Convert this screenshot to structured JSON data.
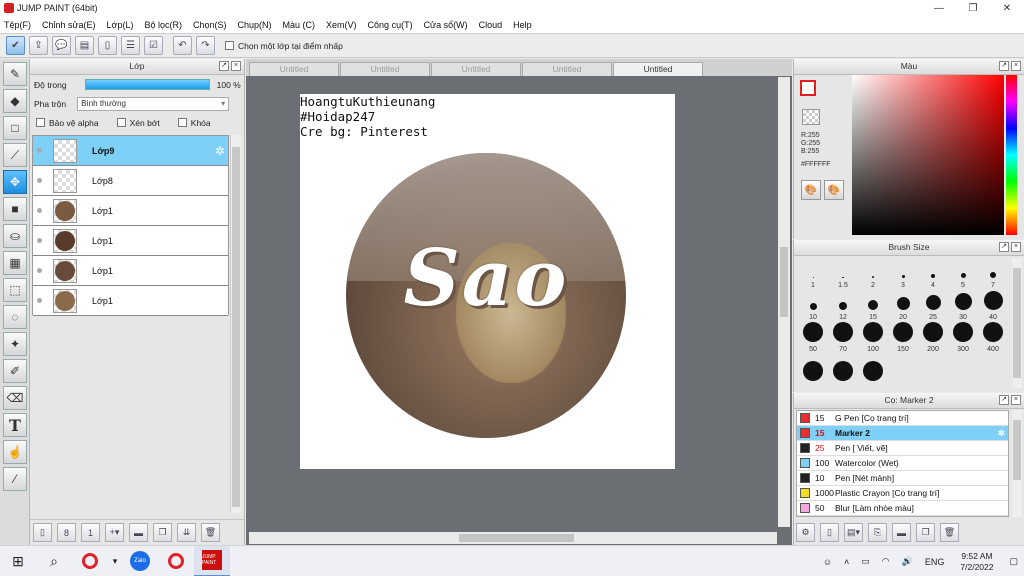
{
  "app": {
    "title": "JUMP PAINT (64bit)"
  },
  "window_controls": {
    "minimize": "—",
    "maximize": "❐",
    "close": "✕"
  },
  "menu": [
    "Tệp(F)",
    "Chỉnh sửa(E)",
    "Lớp(L)",
    "Bộ lọc(R)",
    "Chọn(S)",
    "Chụp(N)",
    "Màu (C)",
    "Xem(V)",
    "Công cụ(T)",
    "Cửa sổ(W)",
    "Cloud",
    "Help"
  ],
  "toolbar": {
    "checkbox_label": "Chọn một lớp tại điểm nhấp"
  },
  "layer_panel": {
    "title": "Lớp",
    "opacity_label": "Độ trong",
    "opacity_value": "100 %",
    "opacity": 1.0,
    "blend_label": "Pha trộn",
    "blend_value": "Bình thường",
    "protect_alpha": "Bảo vệ alpha",
    "clipping": "Xén bớt",
    "lock": "Khóa",
    "layers": [
      {
        "name": "Lớp9",
        "selected": true,
        "thumb": "empty"
      },
      {
        "name": "Lớp8",
        "selected": false,
        "thumb": "empty"
      },
      {
        "name": "Lớp1",
        "selected": false,
        "thumb": "#7a5a40"
      },
      {
        "name": "Lớp1",
        "selected": false,
        "thumb": "#5a3a2a"
      },
      {
        "name": "Lớp1",
        "selected": false,
        "thumb": "#6a4a3a"
      },
      {
        "name": "Lớp1",
        "selected": false,
        "thumb": "#8a6a4a"
      }
    ]
  },
  "canvas": {
    "tabs": [
      {
        "label": "Untitled",
        "active": false
      },
      {
        "label": "Untitled",
        "active": false
      },
      {
        "label": "Untitled",
        "active": false
      },
      {
        "label": "Untitled",
        "active": false
      },
      {
        "label": "Untitled",
        "active": true
      }
    ],
    "credit_lines": [
      "HoangtuKuthieunang",
      "#Hoidap247",
      "Cre bg: Pinterest"
    ],
    "artwork_text": "Sao"
  },
  "color_panel": {
    "title": "Màu",
    "r": "R:255",
    "g": "G:255",
    "b": "B:255",
    "hex": "#FFFFFF",
    "foreground_color": "#ffffff",
    "accent_color": "#e02020"
  },
  "brush_panel": {
    "title": "Brush Size",
    "sizes": [
      "1",
      "1.5",
      "2",
      "3",
      "4",
      "5",
      "7",
      "10",
      "12",
      "15",
      "20",
      "25",
      "30",
      "40",
      "50",
      "70",
      "100",
      "150",
      "200",
      "300",
      "400",
      "",
      "",
      ""
    ]
  },
  "tool_panel": {
    "title": "Cọ: Marker 2",
    "items": [
      {
        "size": "15",
        "name": "G Pen [Cọ trang trí]",
        "color": "#e83030",
        "selected": false
      },
      {
        "size": "15",
        "name": "Marker 2",
        "color": "#e83030",
        "selected": true
      },
      {
        "size": "25",
        "name": "Pen [ Viết, vẽ]",
        "color": "#222222",
        "selected": false
      },
      {
        "size": "100",
        "name": "Watercolor (Wet)",
        "color": "#7fd0f6",
        "selected": false
      },
      {
        "size": "10",
        "name": "Pen [Nét mảnh]",
        "color": "#222222",
        "selected": false
      },
      {
        "size": "1000",
        "name": "Plastic Crayon [Cọ trang trí]",
        "color": "#f2e020",
        "selected": false
      },
      {
        "size": "50",
        "name": "Blur [Làm nhòe màu]",
        "color": "#f3a8e0",
        "selected": false
      }
    ]
  },
  "taskbar": {
    "lang": "ENG",
    "time": "9:52 AM",
    "date": "7/2/2022",
    "zalo": "Zalo",
    "jp": "JUMP PAINT"
  }
}
